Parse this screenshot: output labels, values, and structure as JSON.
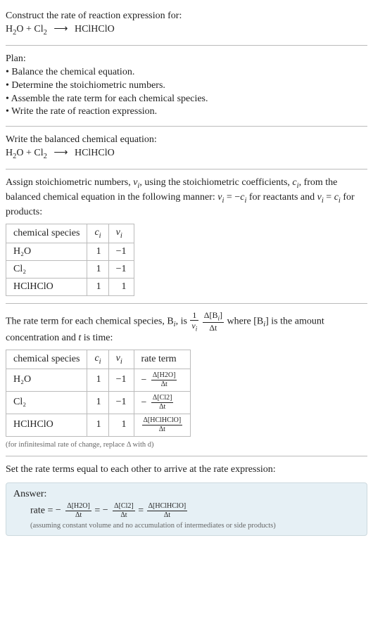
{
  "intro": {
    "prompt_prefix": "Construct the rate of reaction expression for:",
    "reactant1": "H",
    "reactant1_sub": "2",
    "reactant1_tail": "O",
    "plus": "+",
    "reactant2": "Cl",
    "reactant2_sub": "2",
    "arrow": "⟶",
    "product": "HClHClO"
  },
  "plan": {
    "heading": "Plan:",
    "b1": "• Balance the chemical equation.",
    "b2": "• Determine the stoichiometric numbers.",
    "b3": "• Assemble the rate term for each chemical species.",
    "b4": "• Write the rate of reaction expression."
  },
  "balanced": {
    "heading": "Write the balanced chemical equation:"
  },
  "assign": {
    "text1": "Assign stoichiometric numbers, ",
    "nu": "ν",
    "sub_i": "i",
    "text2": ", using the stoichiometric coefficients, ",
    "c": "c",
    "text3": ", from the balanced chemical equation in the following manner: ",
    "eq1a": "ν",
    "eq1b": "i",
    "eq1c": " = −",
    "eq1d": "c",
    "eq1e": "i",
    "text4": " for reactants and ",
    "eq2a": "ν",
    "eq2b": "i",
    "eq2c": " = ",
    "eq2d": "c",
    "eq2e": "i",
    "text5": " for products:"
  },
  "table1": {
    "h1": "chemical species",
    "h2": "c",
    "h2sub": "i",
    "h3": "ν",
    "h3sub": "i",
    "r1s": "H₂O",
    "r1c": "1",
    "r1n": "−1",
    "r2s": "Cl₂",
    "r2c": "1",
    "r2n": "−1",
    "r3s": "HClHClO",
    "r3c": "1",
    "r3n": "1"
  },
  "rateterm": {
    "text1": "The rate term for each chemical species, B",
    "sub_i": "i",
    "text2": ", is ",
    "frac1num": "1",
    "frac1den_a": "ν",
    "frac1den_b": "i",
    "frac2num_a": "Δ[B",
    "frac2num_b": "i",
    "frac2num_c": "]",
    "frac2den": "Δt",
    "text3": " where [B",
    "text4": "] is the amount concentration and ",
    "t": "t",
    "text5": " is time:"
  },
  "table2": {
    "h1": "chemical species",
    "h2": "c",
    "h2sub": "i",
    "h3": "ν",
    "h3sub": "i",
    "h4": "rate term",
    "r1s": "H₂O",
    "r1c": "1",
    "r1n": "−1",
    "r1rt_num": "Δ[H2O]",
    "r1rt_den": "Δt",
    "r2s": "Cl₂",
    "r2c": "1",
    "r2n": "−1",
    "r2rt_num": "Δ[Cl2]",
    "r2rt_den": "Δt",
    "r3s": "HClHClO",
    "r3c": "1",
    "r3n": "1",
    "r3rt_num": "Δ[HClHClO]",
    "r3rt_den": "Δt"
  },
  "note": "(for infinitesimal rate of change, replace Δ with d)",
  "setequal": "Set the rate terms equal to each other to arrive at the rate expression:",
  "answer": {
    "label": "Answer:",
    "rate": "rate",
    "eq": " = ",
    "neg": "−",
    "f1num": "Δ[H2O]",
    "f1den": "Δt",
    "f2num": "Δ[Cl2]",
    "f2den": "Δt",
    "f3num": "Δ[HClHClO]",
    "f3den": "Δt",
    "assume": "(assuming constant volume and no accumulation of intermediates or side products)"
  }
}
